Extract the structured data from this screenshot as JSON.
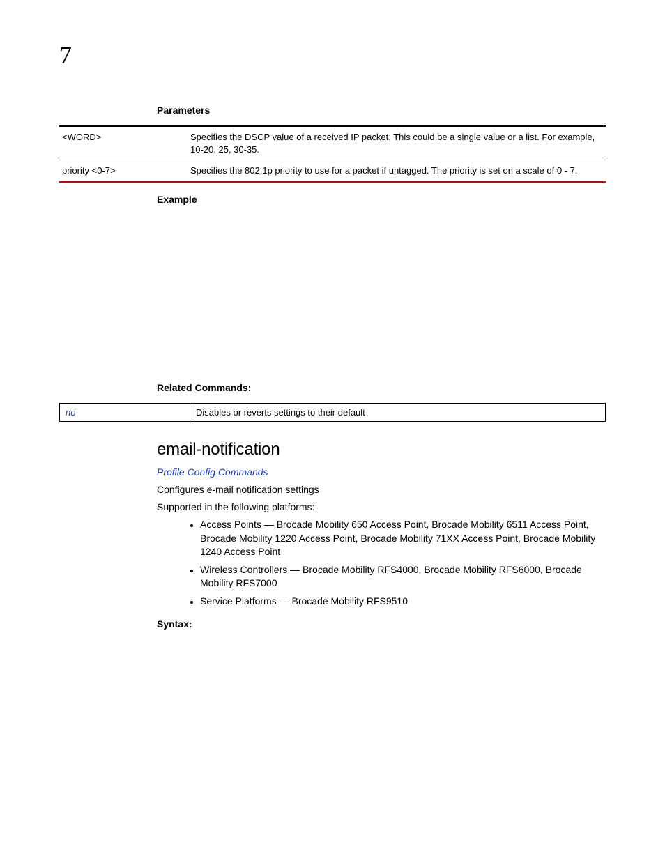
{
  "page": {
    "chapter_number": "7"
  },
  "parameters": {
    "heading": "Parameters",
    "rows": [
      {
        "param": "<WORD>",
        "desc": "Specifies the DSCP value of a received IP packet. This could be a single value or a list. For example, 10-20, 25, 30-35."
      },
      {
        "param": "priority <0-7>",
        "desc": "Specifies the 802.1p priority to use for a packet if untagged. The priority is set on a scale of 0 - 7."
      }
    ]
  },
  "example": {
    "heading": "Example"
  },
  "related": {
    "heading": "Related Commands:",
    "rows": [
      {
        "cmd": "no",
        "desc": "Disables or reverts settings to their default"
      }
    ]
  },
  "command": {
    "title": "email-notification",
    "breadcrumb": "Profile Config Commands",
    "desc": "Configures e-mail notification settings",
    "supported_intro": "Supported in the following platforms:",
    "platforms": [
      "Access Points — Brocade Mobility 650 Access Point, Brocade Mobility 6511 Access Point, Brocade Mobility 1220 Access Point, Brocade Mobility 71XX Access Point, Brocade Mobility 1240 Access Point",
      "Wireless Controllers — Brocade Mobility RFS4000, Brocade Mobility RFS6000, Brocade Mobility RFS7000",
      "Service Platforms — Brocade Mobility RFS9510"
    ]
  },
  "syntax": {
    "heading": "Syntax:"
  }
}
